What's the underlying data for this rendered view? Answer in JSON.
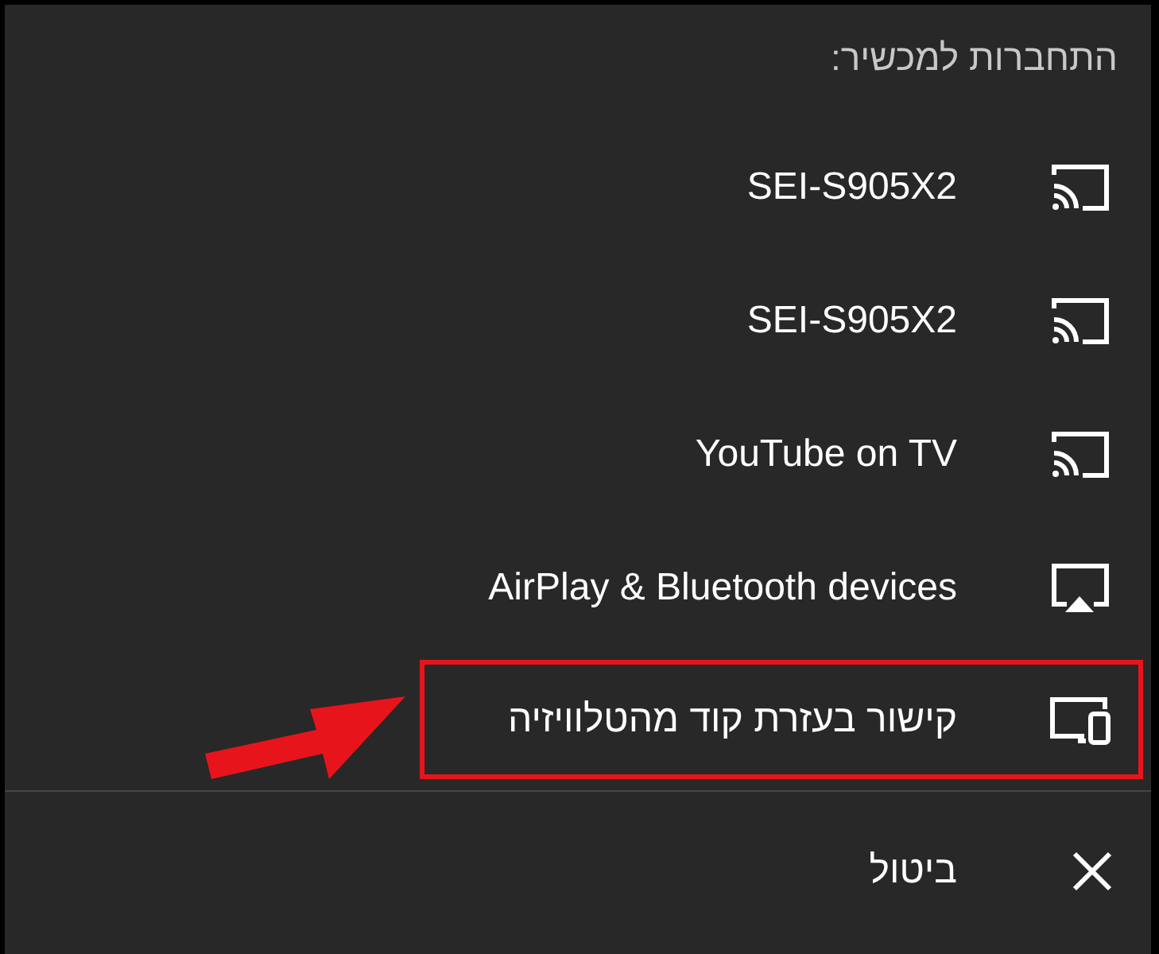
{
  "header": "התחברות למכשיר:",
  "devices": [
    {
      "label": "SEI-S905X2",
      "kind": "cast",
      "highlighted": false
    },
    {
      "label": "SEI-S905X2",
      "kind": "cast",
      "highlighted": false
    },
    {
      "label": "YouTube on TV",
      "kind": "cast",
      "highlighted": false
    },
    {
      "label": "AirPlay & Bluetooth devices",
      "kind": "airplay",
      "highlighted": false
    },
    {
      "label": "קישור בעזרת קוד מהטלוויזיה",
      "kind": "link-tv",
      "highlighted": true
    }
  ],
  "cancel": "ביטול"
}
